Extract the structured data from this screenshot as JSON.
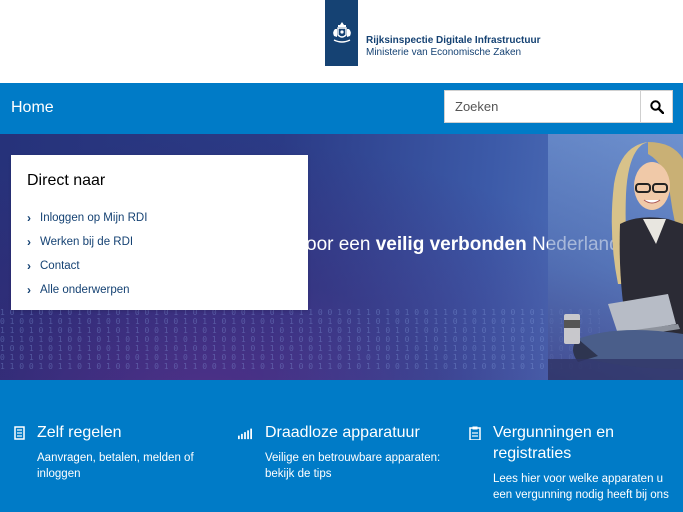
{
  "header": {
    "org_name": "Rijksinspectie Digitale Infrastructuur",
    "ministry": "Ministerie van Economische Zaken",
    "logo_icon": "coat-of-arms-icon",
    "logo_color": "#154273"
  },
  "nav": {
    "home_label": "Home",
    "search_placeholder": "Zoeken",
    "search_icon": "search-icon",
    "bar_color": "#007bc7"
  },
  "hero": {
    "tagline_pre": "oor een ",
    "tagline_bold": "veilig verbonden",
    "tagline_post": " Nederland"
  },
  "direct": {
    "title": "Direct naar",
    "items": [
      {
        "label": "Inloggen op Mijn RDI"
      },
      {
        "label": "Werken bij de RDI"
      },
      {
        "label": "Contact"
      },
      {
        "label": "Alle onderwerpen"
      }
    ]
  },
  "tiles": [
    {
      "icon": "document-icon",
      "title": "Zelf regelen",
      "desc": "Aanvragen, betalen, melden of inloggen"
    },
    {
      "icon": "signal-bars-icon",
      "title": "Draadloze apparatuur",
      "desc": "Veilige en betrouwbare apparaten: bekijk de tips"
    },
    {
      "icon": "clipboard-icon",
      "title": "Vergunningen en registraties",
      "desc": "Lees hier voor welke apparaten u een vergunning nodig heeft bij ons"
    }
  ]
}
